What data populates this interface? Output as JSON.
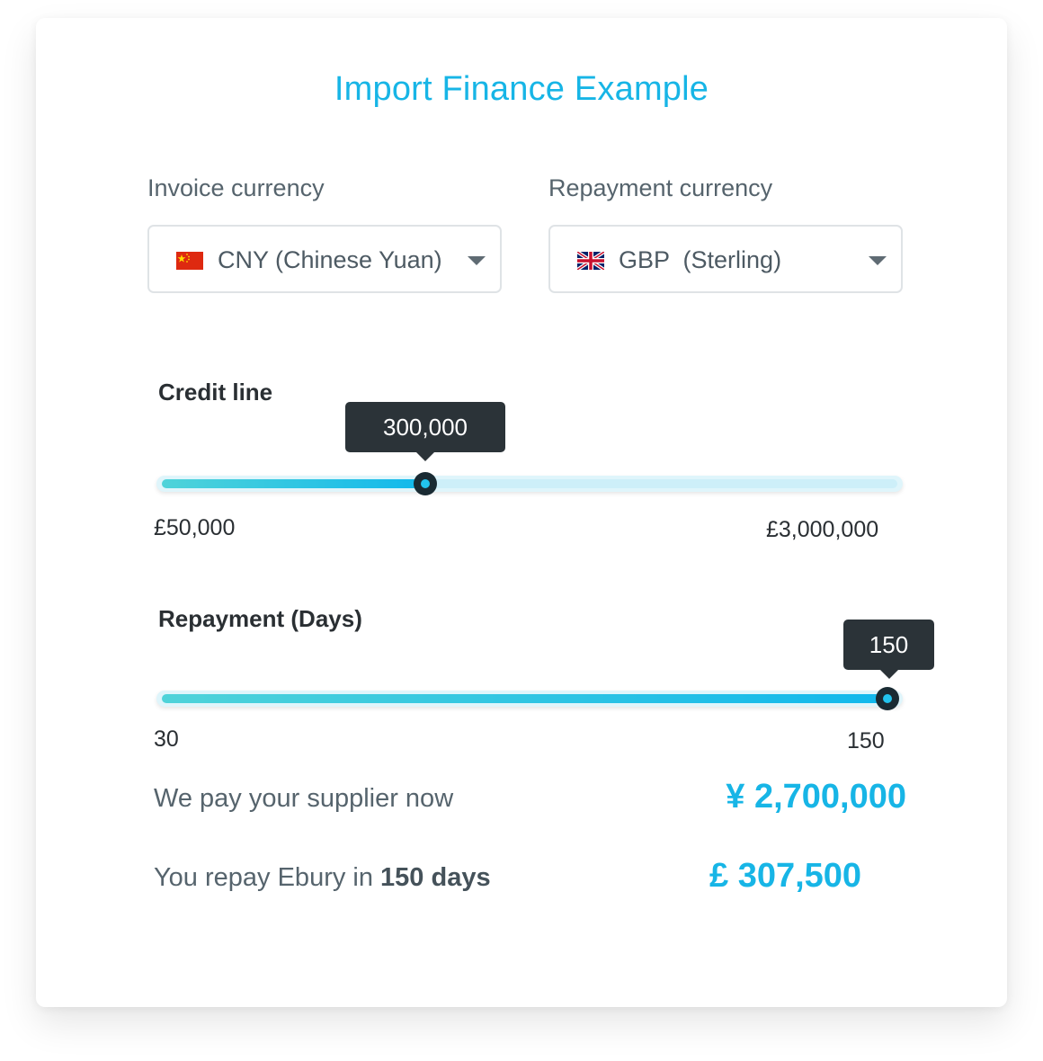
{
  "title": "Import Finance Example",
  "invoice": {
    "label": "Invoice currency",
    "selected": "CNY (Chinese Yuan)",
    "flag_icon": "china-flag-icon"
  },
  "repayment_currency": {
    "label": "Repayment currency",
    "selected": "GBP  (Sterling)",
    "flag_icon": "uk-flag-icon"
  },
  "credit_line": {
    "label": "Credit line",
    "value_display": "300,000",
    "value": 300000,
    "min_label": "£50,000",
    "max_label": "£3,000,000",
    "min": 50000,
    "max": 3000000
  },
  "repayment_days": {
    "label": "Repayment (Days)",
    "value_display": "150",
    "value": 150,
    "min_label": "30",
    "max_label": "150",
    "min": 30,
    "max": 150
  },
  "summary": {
    "pay_label": "We pay your supplier now",
    "pay_value": "¥ 2,700,000",
    "repay_label_prefix": "You repay Ebury in ",
    "repay_label_bold": "150 days",
    "repay_value": "£ 307,500"
  },
  "colors": {
    "accent": "#17b5e6",
    "tooltip_bg": "#2b3338",
    "text_muted": "#56646d"
  }
}
